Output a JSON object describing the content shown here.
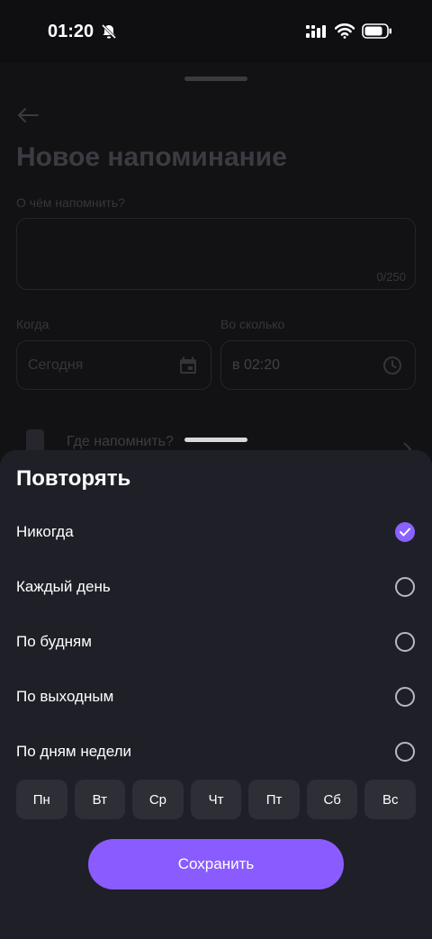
{
  "status_bar": {
    "time": "01:20",
    "icons": [
      "bell-off-icon",
      "signal-icon",
      "wifi-icon",
      "battery-icon"
    ]
  },
  "background_screen": {
    "title": "Новое напоминание",
    "about_label": "О чём напомнить?",
    "about_value": "",
    "counter": "0/250",
    "when_label": "Когда",
    "date_value": "Сегодня",
    "time_label": "Во сколько",
    "time_value": "в 02:20",
    "where_label": "Где напомнить?"
  },
  "sheet": {
    "title": "Повторять",
    "options": [
      {
        "label": "Никогда",
        "selected": true
      },
      {
        "label": "Каждый день",
        "selected": false
      },
      {
        "label": "По будням",
        "selected": false
      },
      {
        "label": "По выходным",
        "selected": false
      },
      {
        "label": "По дням недели",
        "selected": false
      }
    ],
    "days": [
      "Пн",
      "Вт",
      "Ср",
      "Чт",
      "Пт",
      "Сб",
      "Вс"
    ],
    "save_label": "Сохранить"
  },
  "colors": {
    "accent": "#8a5cff",
    "sheet_bg": "#1f1f28",
    "screen_bg": "#121215"
  }
}
